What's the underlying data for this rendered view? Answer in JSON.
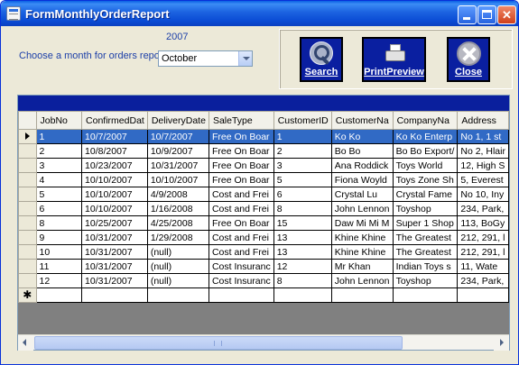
{
  "window": {
    "title": "FormMonthlyOrderReport",
    "minimize_glyph": "",
    "close_glyph": "✕"
  },
  "filters": {
    "year": "2007",
    "month_label": "Choose a month for orders report at",
    "month_value": "October"
  },
  "buttons": {
    "search": "Search",
    "print_preview": "PrintPreview",
    "close": "Close"
  },
  "grid": {
    "columns": [
      "JobNo",
      "ConfirmedDat",
      "DeliveryDate",
      "SaleType",
      "CustomerID",
      "CustomerNa",
      "CompanyNa",
      "Address"
    ],
    "rows": [
      [
        "1",
        "10/7/2007",
        "10/7/2007",
        "Free On Boar",
        "1",
        "Ko Ko",
        "Ko Ko Enterp",
        "No 1, 1 st"
      ],
      [
        "2",
        "10/8/2007",
        "10/9/2007",
        "Free On Boar",
        "2",
        "Bo Bo",
        "Bo Bo Export/",
        "No 2, Hlair"
      ],
      [
        "3",
        "10/23/2007",
        "10/31/2007",
        "Free On Boar",
        "3",
        "Ana Roddick",
        "Toys World",
        "12, High S"
      ],
      [
        "4",
        "10/10/2007",
        "10/10/2007",
        "Free On Boar",
        "5",
        "Fiona Woyld",
        "Toys Zone Sh",
        "5, Everest"
      ],
      [
        "5",
        "10/10/2007",
        "4/9/2008",
        "Cost and Frei",
        "6",
        "Crystal Lu",
        "Crystal Fame",
        "No 10, Iny"
      ],
      [
        "6",
        "10/10/2007",
        "1/16/2008",
        "Cost and Frei",
        "8",
        "John Lennon",
        "Toyshop",
        "234, Park,"
      ],
      [
        "8",
        "10/25/2007",
        "4/25/2008",
        "Free On Boar",
        "15",
        "Daw Mi Mi M",
        "Super 1 Shop",
        "113, BoGy"
      ],
      [
        "9",
        "10/31/2007",
        "1/29/2008",
        "Cost and Frei",
        "13",
        "Khine Khine",
        "The Greatest",
        "212, 291, l"
      ],
      [
        "10",
        "10/31/2007",
        "(null)",
        "Cost and Frei",
        "13",
        "Khine Khine",
        "The Greatest",
        "212, 291, l"
      ],
      [
        "11",
        "10/31/2007",
        "(null)",
        "Cost Insuranc",
        "12",
        "Mr Khan",
        "Indian Toys s",
        "11, Wate"
      ],
      [
        "12",
        "10/31/2007",
        "(null)",
        "Cost Insuranc",
        "8",
        "John Lennon",
        "Toyshop",
        "234, Park,"
      ]
    ],
    "selected_row": 0,
    "new_row_marker": "✱"
  },
  "colors": {
    "title_bar": "#0a4bd4",
    "button_bg": "#0a1fa0",
    "selection": "#316ac5",
    "label_text": "#1c3fa8"
  },
  "icons": {
    "search": "magnifier-icon",
    "print": "printer-icon",
    "close": "close-x-icon"
  }
}
